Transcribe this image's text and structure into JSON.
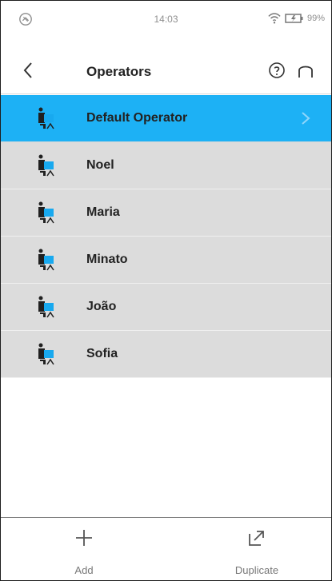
{
  "status_bar": {
    "time": "14:03",
    "battery_percent": "99%",
    "icons": {
      "app": "app-icon",
      "wifi": "wifi-icon",
      "battery": "battery-icon"
    }
  },
  "header": {
    "title": "Operators",
    "icons": {
      "back": "back-icon",
      "help": "help-icon",
      "home": "home-icon"
    }
  },
  "operators": [
    {
      "name": "Default Operator",
      "selected": true,
      "icon": "operator-icon",
      "chevron_icon": "chevron-right-icon"
    },
    {
      "name": "Noel",
      "selected": false,
      "icon": "operator-icon"
    },
    {
      "name": "Maria",
      "selected": false,
      "icon": "operator-icon"
    },
    {
      "name": "Minato",
      "selected": false,
      "icon": "operator-icon"
    },
    {
      "name": "João",
      "selected": false,
      "icon": "operator-icon"
    },
    {
      "name": "Sofia",
      "selected": false,
      "icon": "operator-icon"
    }
  ],
  "bottom_bar": {
    "add_label": "Add",
    "duplicate_label": "Duplicate",
    "icons": {
      "add": "plus-icon",
      "duplicate": "duplicate-icon"
    }
  },
  "colors": {
    "selected_row": "#1db1f5",
    "row_background": "#dcdcdc",
    "operator_icon_blue": "#18a9ef",
    "text_primary": "#222222"
  }
}
